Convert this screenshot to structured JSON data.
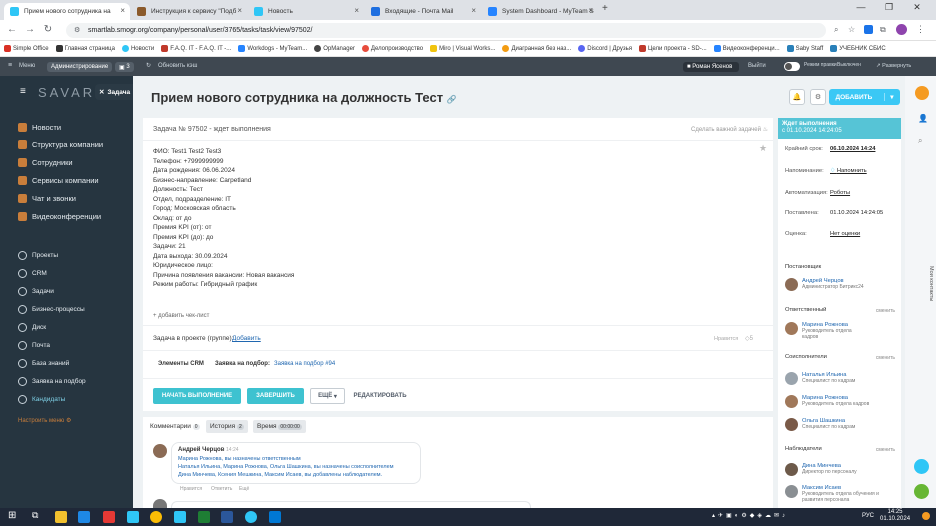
{
  "browser": {
    "tabs": [
      {
        "title": "Прием нового сотрудника на",
        "color": "#2fc6f6"
      },
      {
        "title": "Инструкция к сервису \"Подб",
        "color": "#8b5a2b"
      },
      {
        "title": "Новость",
        "color": "#2fc6f6"
      },
      {
        "title": "Входящие - Почта Mail",
        "color": "#1f6fe0"
      },
      {
        "title": "System Dashboard - MyTeam S",
        "color": "#2684ff"
      }
    ],
    "url": "smartlab.smogr.org/company/personal/user/3765/tasks/task/view/97502/",
    "bookmarks": [
      "Simple Office",
      "Главная страница",
      "Новости",
      "F.A.Q. IT - F.A.Q. IT -...",
      "Workdogs - MyTeam...",
      "OpManager",
      "Делопроизводство",
      "Miro | Visual Works...",
      "Диагранная без наз...",
      "Discord | Друзья",
      "Цели проекта - SD-...",
      "Видеоконференци...",
      "Saby Staff",
      "УЧЕБНИК СБИС"
    ]
  },
  "topbar": {
    "menu": "Меню",
    "admin": "Администрирование",
    "count": "3",
    "refresh": "Обновить кэш",
    "user": "Роман Ясенов",
    "logout": "Выйти",
    "toggle": "Режим правки",
    "toggle_state": "Выключен",
    "expand": "Развернуть"
  },
  "leftmenu": {
    "brand": "SAVAR",
    "items": [
      "Новости",
      "Структура компании",
      "Сотрудники",
      "Сервисы компании",
      "Чат и звонки",
      "Видеоконференции"
    ],
    "small_items": [
      "Проекты",
      "CRM",
      "Задачи",
      "Бизнес-процессы",
      "Диск",
      "Почта",
      "База знаний",
      "Заявка на подбор",
      "Кандидаты"
    ],
    "settings": "Настроить меню"
  },
  "task": {
    "slider_label": "Задача",
    "title": "Прием нового сотрудника на должность Тест",
    "add_button": "ДОБАВИТЬ",
    "subtitle": "Задача № 97502 - ждет выполнения",
    "important": "Сделать важной задачей",
    "description": [
      "ФИО: Test1 Test2 Test3",
      "Телефон: +7999999999",
      "Дата рождения: 06.06.2024",
      "Бизнес-направление: Carpetland",
      "Должность: Тест",
      "Отдел, подразделение: IT",
      "Город: Московская область",
      "Оклад: от  до",
      "Премия KPI (от): от",
      "Премия KPI (до): до",
      "Задачи: 21",
      "Дата выхода: 30.09.2024",
      "Юридическое лицо:",
      "Причина появления вакансии: Новая вакансия",
      "Режим работы: Гибридный график"
    ],
    "add_checklist": "+ добавить чек-лист",
    "project_label": "Задача в проекте (группе):",
    "project_link": "Добавить",
    "hint": "Нравится",
    "likes": "5",
    "crm_label": "Элементы CRM",
    "crm_type": "Заявка на подбор:",
    "crm_link": "Заявка на подбор #94",
    "btn_start": "НАЧАТЬ ВЫПОЛНЕНИЕ",
    "btn_finish": "ЗАВЕРШИТЬ",
    "btn_more": "ЕЩЁ",
    "btn_edit": "РЕДАКТИРОВАТЬ"
  },
  "comments": {
    "tabs": [
      {
        "label": "Комментарии",
        "count": "0"
      },
      {
        "label": "История",
        "count": "2"
      },
      {
        "label": "Время",
        "count": "00:00:00"
      }
    ],
    "author": "Андрей Черцов",
    "time": "14:24",
    "lines": [
      "Марина Рожнова, вы назначены ответственным",
      "Наталья Ильина, Марина Рожнова, Ольга Шашкина, вы назначены соисполнителем",
      "Дина Минчева, Ксения Мешкина, Максим Исаев, вы добавлены наблюдателем."
    ],
    "actions": [
      "Нравится",
      "Ответить",
      "Ещё"
    ]
  },
  "sidebar": {
    "status_title": "Ждет выполнения",
    "status_sub": "с 01.10.2024 14:24:05",
    "rows": [
      {
        "label": "Крайний срок:",
        "value": "06.10.2024 14:24"
      },
      {
        "label": "Напоминание:",
        "value": "Напомнить"
      },
      {
        "label": "Автоматизация:",
        "value": "Роботы"
      },
      {
        "label": "Поставлена:",
        "value": "01.10.2024 14:24:05"
      },
      {
        "label": "Оценка:",
        "value": "Нет оценки"
      }
    ],
    "creator_head": "Постановщик",
    "creator": {
      "name": "Андрей Черцов",
      "role": "Администратор Битрикс24"
    },
    "resp_head": "Ответственный",
    "change": "сменить",
    "responsible": {
      "name": "Марина Рожнова",
      "role": "Руководитель отдела кадров"
    },
    "acc_head": "Соисполнители",
    "accomplices": [
      {
        "name": "Наталья Ильина",
        "role": "Специалист по кадрам"
      },
      {
        "name": "Марина Рожнова",
        "role": "Руководитель отдела кадров"
      },
      {
        "name": "Ольга Шашкина",
        "role": "Специалист по кадрам"
      }
    ],
    "aud_head": "Наблюдатели",
    "auditors": [
      {
        "name": "Дина Минчева",
        "role": "Директор по персоналу"
      },
      {
        "name": "Максим Исаев",
        "role": "Руководитель отдела обучения и развития персонала"
      }
    ]
  },
  "rightrail": {
    "label": "Мои контакты"
  },
  "taskbar": {
    "time": "14:25",
    "date": "01.10.2024",
    "lang": "РУС"
  }
}
